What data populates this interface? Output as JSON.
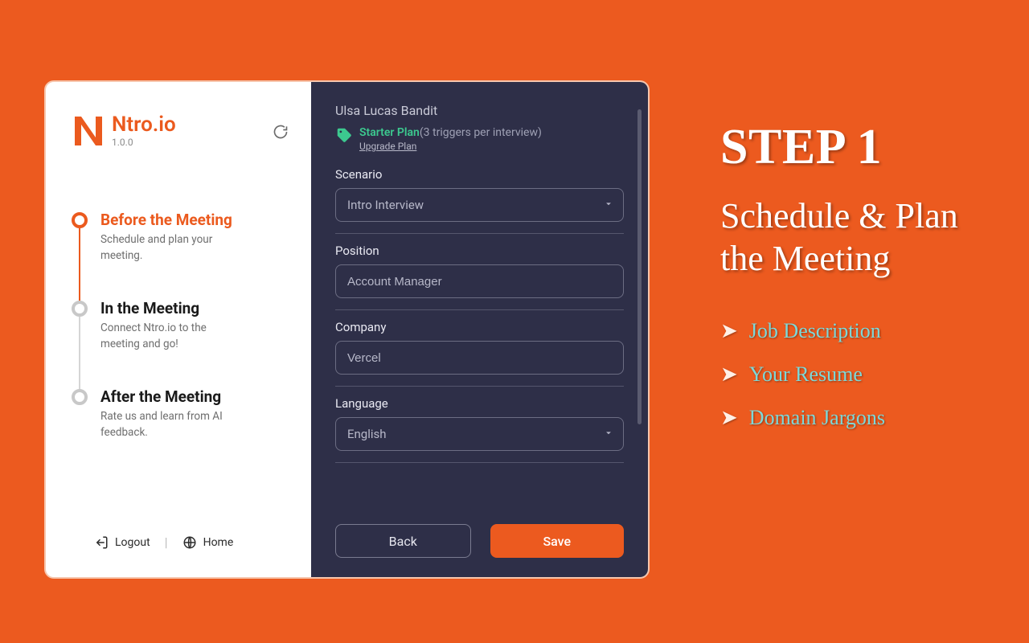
{
  "brand": {
    "name": "Ntro.io",
    "version": "1.0.0"
  },
  "sidebar": {
    "steps": [
      {
        "title": "Before the Meeting",
        "desc": "Schedule and plan your meeting."
      },
      {
        "title": "In the Meeting",
        "desc": "Connect Ntro.io to the meeting and go!"
      },
      {
        "title": "After the Meeting",
        "desc": "Rate us and learn from AI feedback."
      }
    ],
    "logout_label": "Logout",
    "home_label": "Home"
  },
  "panel": {
    "user_name": "Ulsa Lucas Bandit",
    "plan_name": "Starter Plan",
    "plan_note": "(3 triggers per interview)",
    "upgrade_label": "Upgrade Plan",
    "fields": {
      "scenario_label": "Scenario",
      "scenario_value": "Intro Interview",
      "position_label": "Position",
      "position_value": "Account Manager",
      "company_label": "Company",
      "company_value": "Vercel",
      "language_label": "Language",
      "language_value": "English"
    },
    "back_label": "Back",
    "save_label": "Save"
  },
  "promo": {
    "step_heading": "STEP 1",
    "subtitle": "Schedule & Plan the Meeting",
    "bullets": [
      "Job Description",
      "Your Resume",
      "Domain Jargons"
    ]
  }
}
